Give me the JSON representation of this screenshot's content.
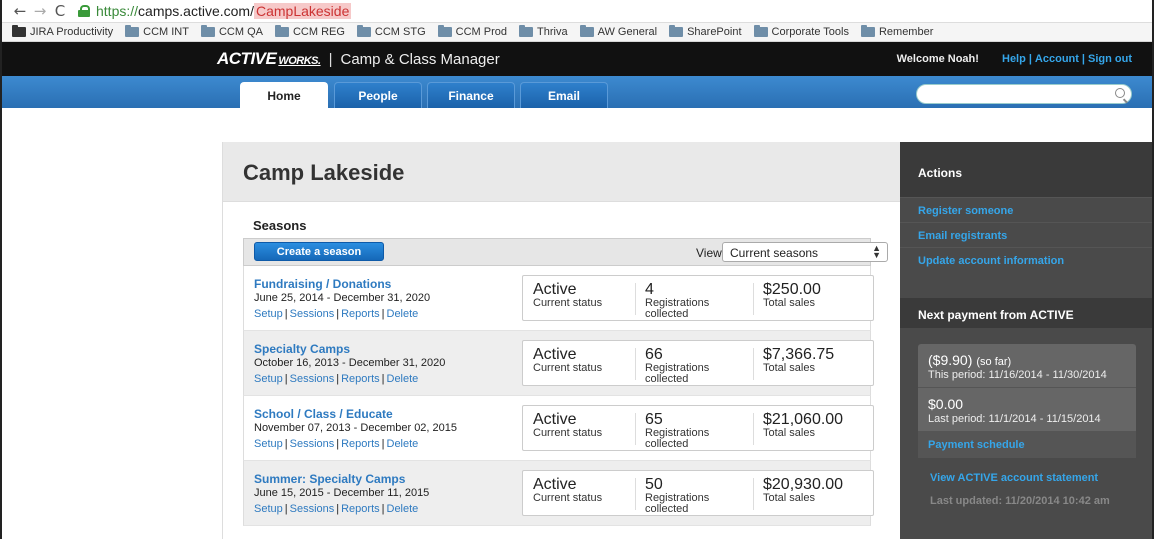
{
  "browser": {
    "nav_back": "←",
    "nav_forward": "→",
    "reload": "C",
    "url_scheme": "https://",
    "url_host": "camps.active.com/",
    "url_path": "CampLakeside"
  },
  "bookmarks": [
    "JIRA Productivity",
    "CCM INT",
    "CCM QA",
    "CCM REG",
    "CCM STG",
    "CCM Prod",
    "Thriva",
    "AW General",
    "SharePoint",
    "Corporate Tools",
    "Remember"
  ],
  "header": {
    "logo": "ACTIVE",
    "logo_suffix": "WORKS.",
    "separator": "|",
    "app_name": "Camp & Class Manager",
    "welcome": "Welcome Noah!",
    "help": "Help",
    "account": "Account",
    "signout": "Sign out",
    "pipe": "|"
  },
  "nav": {
    "tabs": [
      "Home",
      "People",
      "Finance",
      "Email"
    ],
    "active_tab": "Home",
    "search_placeholder": ""
  },
  "page": {
    "title": "Camp Lakeside",
    "seasons_heading": "Seasons",
    "create_button": "Create a season",
    "view_label": "View",
    "view_selected": "Current seasons",
    "arrows": "▲▼"
  },
  "seasons": [
    {
      "name": "Fundraising / Donations",
      "dates": "June 25, 2014 - December 31, 2020",
      "status": "Active",
      "status_label": "Current status",
      "registrations": "4",
      "registrations_label": "Registrations collected",
      "sales": "$250.00",
      "sales_label": "Total sales"
    },
    {
      "name": "Specialty Camps",
      "dates": "October 16, 2013 - December 31, 2020",
      "status": "Active",
      "status_label": "Current status",
      "registrations": "66",
      "registrations_label": "Registrations collected",
      "sales": "$7,366.75",
      "sales_label": "Total sales"
    },
    {
      "name": "School / Class / Educate",
      "dates": "November 07, 2013 - December 02, 2015",
      "status": "Active",
      "status_label": "Current status",
      "registrations": "65",
      "registrations_label": "Registrations collected",
      "sales": "$21,060.00",
      "sales_label": "Total sales"
    },
    {
      "name": "Summer: Specialty Camps",
      "dates": "June 15, 2015 - December 11, 2015",
      "status": "Active",
      "status_label": "Current status",
      "registrations": "50",
      "registrations_label": "Registrations collected",
      "sales": "$20,930.00",
      "sales_label": "Total sales"
    }
  ],
  "season_links": {
    "setup": "Setup",
    "sessions": "Sessions",
    "reports": "Reports",
    "delete": "Delete",
    "pipe": "|"
  },
  "sidebar": {
    "actions_heading": "Actions",
    "actions": [
      "Register someone",
      "Email registrants",
      "Update account information"
    ],
    "next_payment_heading": "Next payment from ACTIVE",
    "current_amount": "($9.90)",
    "current_note": "(so far)",
    "current_period": "This period: 11/16/2014 - 11/30/2014",
    "last_amount": "$0.00",
    "last_period": "Last period: 11/1/2014 - 11/15/2014",
    "payment_schedule": "Payment schedule",
    "statement_link": "View ACTIVE account statement",
    "last_updated": "Last updated: 11/20/2014 10:42 am"
  },
  "colors": {
    "link_blue": "#2e7ac0",
    "sidebar_link": "#35a6ea",
    "nav_blue": "#2a6fb3",
    "header_black": "#111111",
    "sidebar_bg": "#4a4a4a"
  }
}
